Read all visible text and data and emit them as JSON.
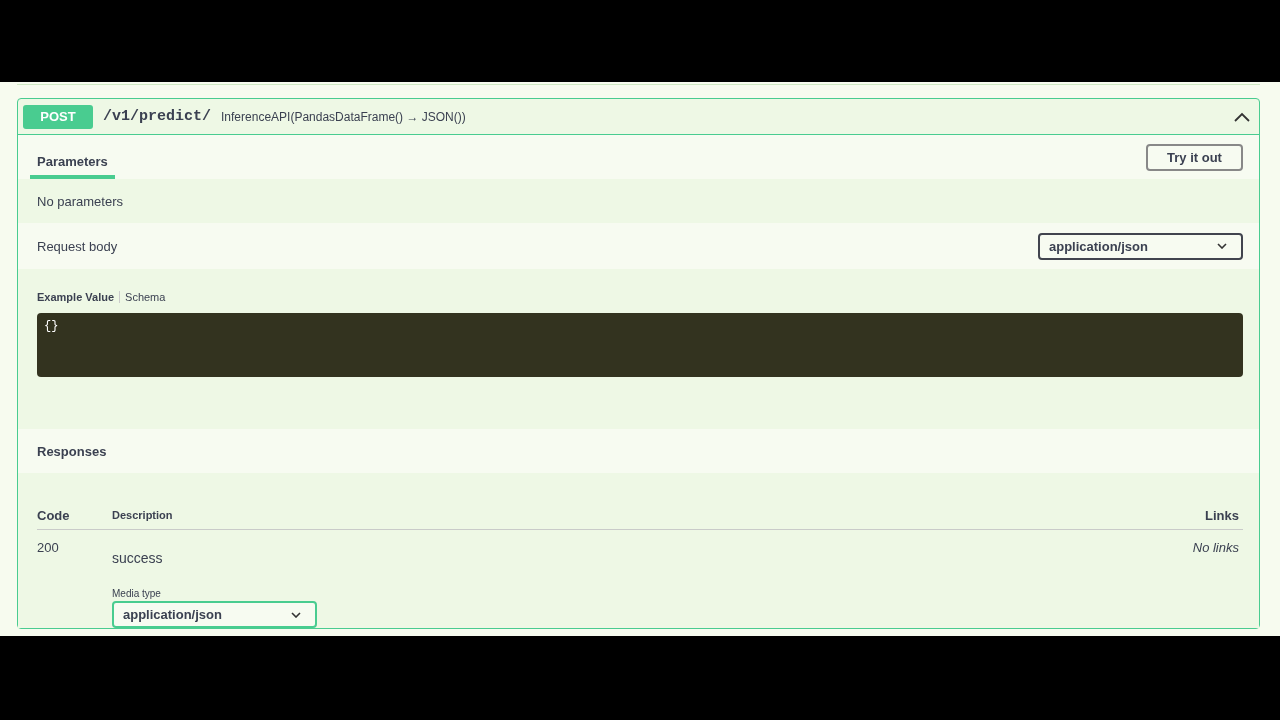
{
  "operation": {
    "method": "POST",
    "path": "/v1/predict/",
    "summary": "InferenceAPI(PandasDataFrame() → JSON())",
    "expanded": true
  },
  "tabs": [
    {
      "label": "Parameters",
      "selected": true
    }
  ],
  "try_button": "Try it out",
  "parameters_message": "No parameters",
  "request_body": {
    "label": "Request body",
    "content_type": "application/json",
    "example_tabs": [
      {
        "label": "Example Value",
        "selected": true
      },
      {
        "label": "Schema",
        "selected": false
      }
    ],
    "example": "{}"
  },
  "responses": {
    "title": "Responses",
    "columns": [
      "Code",
      "Description",
      "Links"
    ],
    "rows": [
      {
        "code": "200",
        "description": "success",
        "media_type_label": "Media type",
        "media_type": "application/json",
        "links": "No links"
      }
    ]
  }
}
